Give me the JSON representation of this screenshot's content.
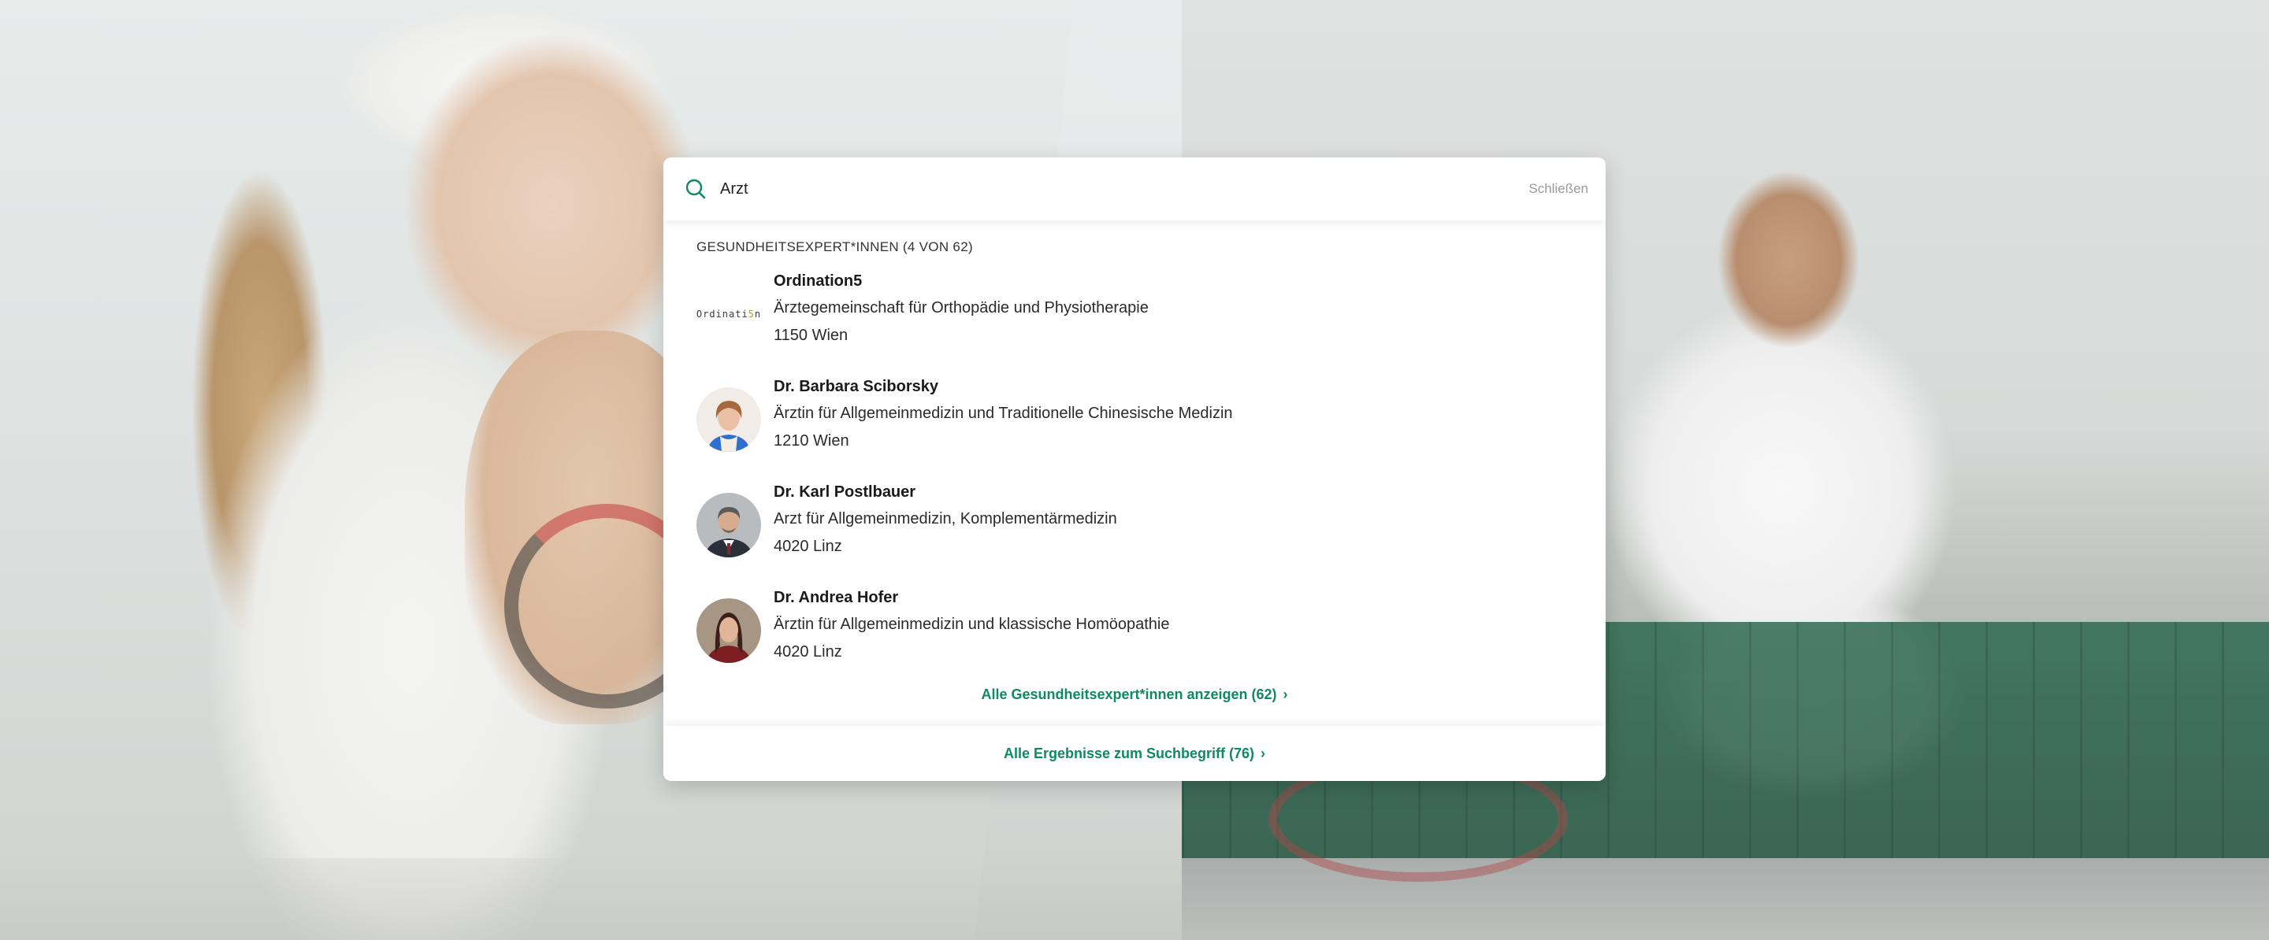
{
  "search": {
    "value": "Arzt",
    "close_label": "Schließen"
  },
  "section": {
    "title": "GESUNDHEITSEXPERT*INNEN (4 VON 62)"
  },
  "results": [
    {
      "name": "Ordination5",
      "description": "Ärztegemeinschaft für Orthopädie und Physiotherapie",
      "address": "1150 Wien",
      "thumb": "logo",
      "logo_text": "Ordinati",
      "logo_highlight": "5",
      "logo_end": "n"
    },
    {
      "name": "Dr. Barbara Sciborsky",
      "description": "Ärztin für Allgemeinmedizin und Traditionelle Chinesische Medizin",
      "address": "1210 Wien",
      "thumb": "avatar-woman-blonde"
    },
    {
      "name": "Dr. Karl Postlbauer",
      "description": "Arzt für Allgemeinmedizin, Komplementärmedizin",
      "address": "4020 Linz",
      "thumb": "avatar-man-suit"
    },
    {
      "name": "Dr. Andrea Hofer",
      "description": "Ärztin für Allgemeinmedizin und klassische Homöopathie",
      "address": "4020 Linz",
      "thumb": "avatar-woman-dark"
    }
  ],
  "links": {
    "show_all_experts": "Alle Gesundheitsexpert*innen anzeigen (62)",
    "all_results": "Alle Ergebnisse zum Suchbegriff (76)",
    "chevron": "›"
  },
  "colors": {
    "accent": "#0f8a5f",
    "muted": "#9a9a9a"
  },
  "icons": [
    "search-icon",
    "chevron-right-icon"
  ]
}
